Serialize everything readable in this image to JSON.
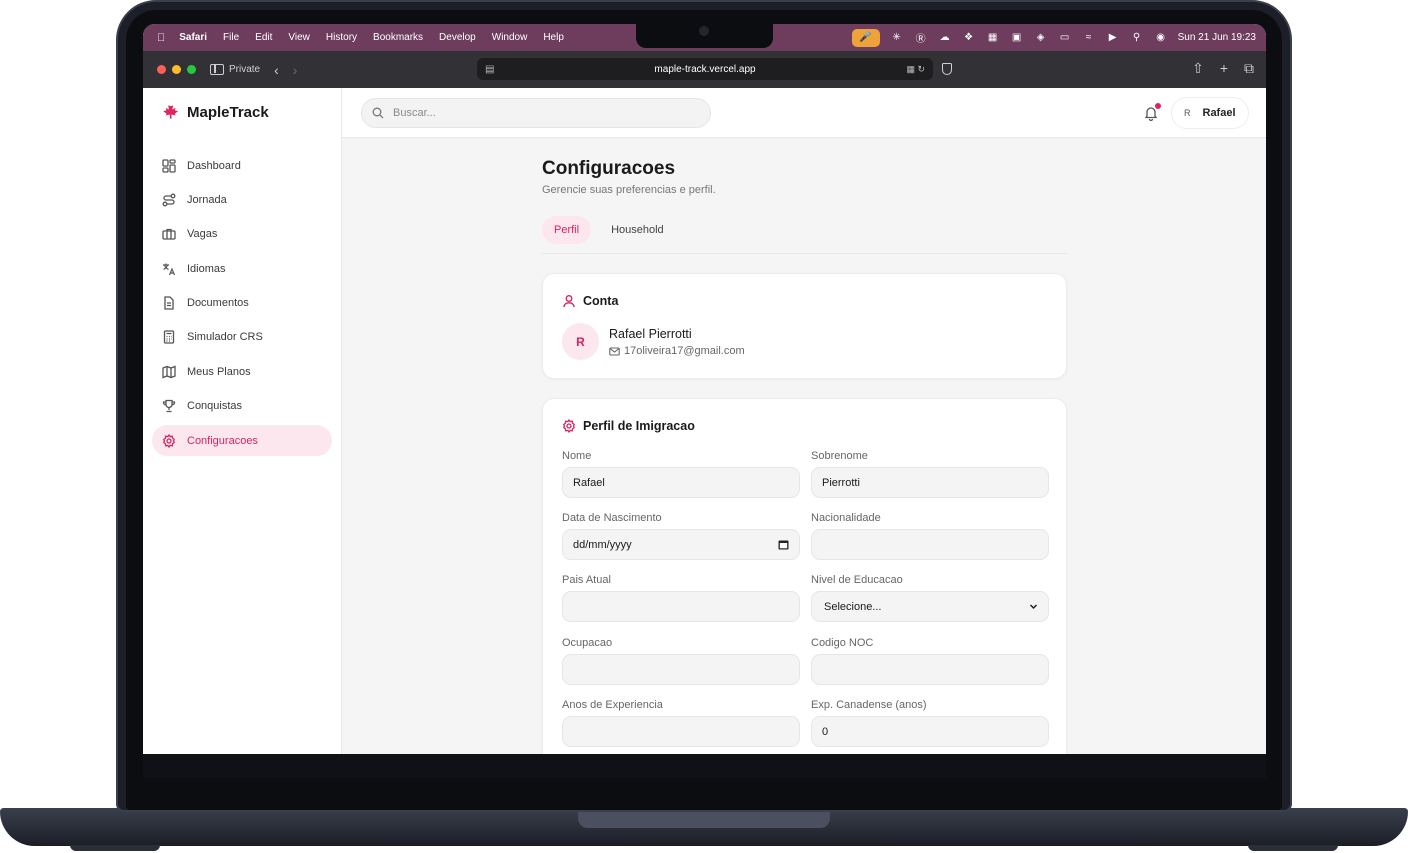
{
  "menubar": {
    "app_name": "Safari",
    "items": [
      "File",
      "Edit",
      "View",
      "History",
      "Bookmarks",
      "Develop",
      "Window",
      "Help"
    ],
    "datetime": "Sun 21 Jun  19:23"
  },
  "browser": {
    "private_label": "Private",
    "url": "maple-track.vercel.app"
  },
  "brand": {
    "name": "MapleTrack",
    "color": "#d6245f"
  },
  "sidebar": {
    "items": [
      {
        "label": "Dashboard",
        "icon": "dashboard-icon"
      },
      {
        "label": "Jornada",
        "icon": "route-icon"
      },
      {
        "label": "Vagas",
        "icon": "briefcase-icon"
      },
      {
        "label": "Idiomas",
        "icon": "translate-icon"
      },
      {
        "label": "Documentos",
        "icon": "document-icon"
      },
      {
        "label": "Simulador CRS",
        "icon": "calculator-icon"
      },
      {
        "label": "Meus Planos",
        "icon": "map-icon"
      },
      {
        "label": "Conquistas",
        "icon": "trophy-icon"
      },
      {
        "label": "Configuracoes",
        "icon": "gear-icon",
        "active": true
      }
    ]
  },
  "topbar": {
    "search_placeholder": "Buscar...",
    "user_initial": "R",
    "user_name": "Rafael"
  },
  "page": {
    "title": "Configuracoes",
    "subtitle": "Gerencie suas preferencias e perfil.",
    "tabs": [
      {
        "label": "Perfil",
        "active": true
      },
      {
        "label": "Household",
        "active": false
      }
    ]
  },
  "account": {
    "heading": "Conta",
    "initial": "R",
    "name": "Rafael Pierrotti",
    "email": "17oliveira17@gmail.com"
  },
  "immigration": {
    "heading": "Perfil de Imigracao",
    "fields": {
      "nome": {
        "label": "Nome",
        "value": "Rafael"
      },
      "sobrenome": {
        "label": "Sobrenome",
        "value": "Pierrotti"
      },
      "nascimento": {
        "label": "Data de Nascimento",
        "value": "dd/mm/yyyy"
      },
      "nacionalidade": {
        "label": "Nacionalidade",
        "value": ""
      },
      "pais": {
        "label": "Pais Atual",
        "value": ""
      },
      "educacao": {
        "label": "Nivel de Educacao",
        "value": "Selecione..."
      },
      "ocupacao": {
        "label": "Ocupacao",
        "value": ""
      },
      "noc": {
        "label": "Codigo NOC",
        "value": ""
      },
      "experiencia": {
        "label": "Anos de Experiencia",
        "value": ""
      },
      "exp_canada": {
        "label": "Exp. Canadense (anos)",
        "value": "0"
      }
    }
  }
}
